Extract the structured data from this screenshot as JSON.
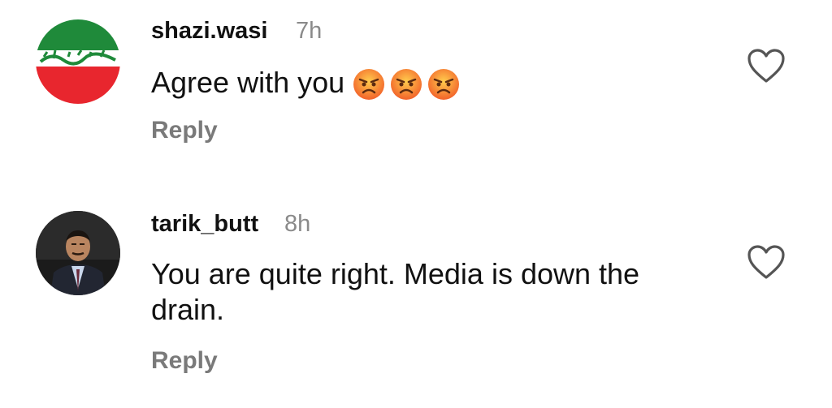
{
  "comments": [
    {
      "avatar_icon": "flag-avatar-icon",
      "username": "shazi.wasi",
      "time": "7h",
      "text": "Agree with you",
      "emojis": [
        "angry-face-icon",
        "angry-face-icon",
        "angry-face-icon"
      ],
      "reply_label": "Reply",
      "like_icon": "heart-outline-icon"
    },
    {
      "avatar_icon": "profile-photo-avatar-icon",
      "username": "tarik_butt",
      "time": "8h",
      "text": "You are quite right. Media is down the drain.",
      "reply_label": "Reply",
      "like_icon": "heart-outline-icon"
    }
  ],
  "colors": {
    "username": "#111111",
    "meta": "#8a8a8a",
    "reply": "#7a7a7a",
    "flag_green": "#1f8a3a",
    "flag_red": "#e8262e"
  }
}
